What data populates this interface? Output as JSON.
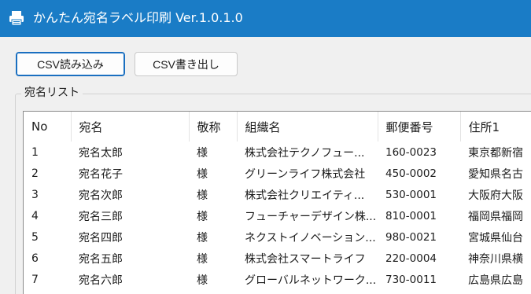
{
  "window": {
    "title": "かんたん宛名ラベル印刷 Ver.1.0.1.0",
    "accent": "#1a7cc6"
  },
  "toolbar": {
    "import_label": "CSV読み込み",
    "export_label": "CSV書き出し"
  },
  "address_list": {
    "group_label": "宛名リスト",
    "columns": [
      "No",
      "宛名",
      "敬称",
      "組織名",
      "郵便番号",
      "住所1"
    ],
    "rows": [
      [
        "1",
        "宛名太郎",
        "様",
        "株式会社テクノフュー...",
        "160-0023",
        "東京都新宿"
      ],
      [
        "2",
        "宛名花子",
        "様",
        "グリーンライフ株式会社",
        "450-0002",
        "愛知県名古"
      ],
      [
        "3",
        "宛名次郎",
        "様",
        "株式会社クリエイティ...",
        "530-0001",
        "大阪府大阪"
      ],
      [
        "4",
        "宛名三郎",
        "様",
        "フューチャーデザイン株...",
        "810-0001",
        "福岡県福岡"
      ],
      [
        "5",
        "宛名四郎",
        "様",
        "ネクストイノベーション...",
        "980-0021",
        "宮城県仙台"
      ],
      [
        "6",
        "宛名五郎",
        "様",
        "株式会社スマートライフ",
        "220-0004",
        "神奈川県横"
      ],
      [
        "7",
        "宛名六郎",
        "様",
        "グローバルネットワーク...",
        "730-0011",
        "広島県広島"
      ]
    ]
  }
}
